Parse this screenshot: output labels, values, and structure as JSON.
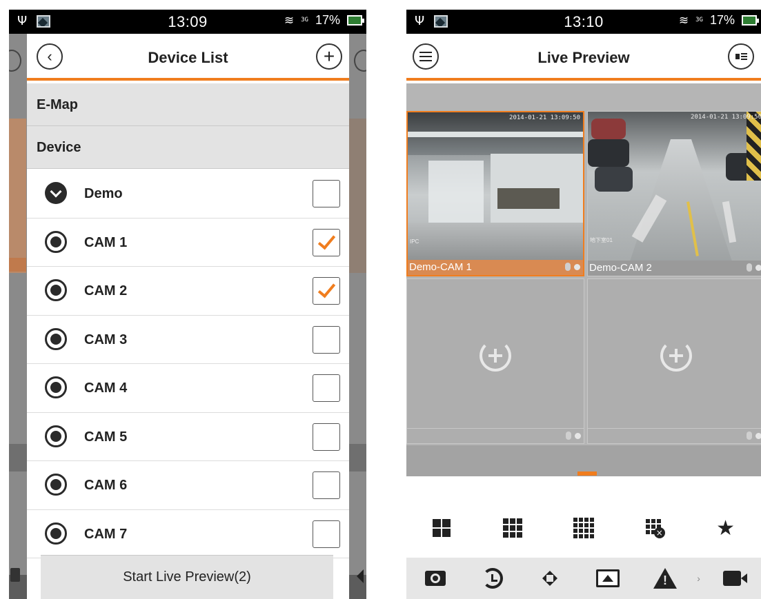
{
  "left_screen": {
    "status_bar": {
      "time": "13:09",
      "network": "3G",
      "battery": "17%"
    },
    "header": {
      "title": "Device List"
    },
    "sections": {
      "emap": "E-Map",
      "device": "Device"
    },
    "devices": [
      {
        "label": "Demo",
        "type": "group",
        "checked": false
      },
      {
        "label": "CAM 1",
        "type": "camera",
        "checked": true
      },
      {
        "label": "CAM 2",
        "type": "camera",
        "checked": true
      },
      {
        "label": "CAM 3",
        "type": "camera",
        "checked": false
      },
      {
        "label": "CAM 4",
        "type": "camera",
        "checked": false
      },
      {
        "label": "CAM 5",
        "type": "camera",
        "checked": false
      },
      {
        "label": "CAM 6",
        "type": "camera",
        "checked": false
      },
      {
        "label": "CAM 7",
        "type": "camera",
        "checked": false
      }
    ],
    "start_button": "Start Live Preview(2)"
  },
  "right_screen": {
    "status_bar": {
      "time": "13:10",
      "network": "3G",
      "battery": "17%"
    },
    "header": {
      "title": "Live Preview"
    },
    "tiles": [
      {
        "caption": "Demo-CAM 1",
        "timestamp": "2014-01-21 13:09:50",
        "osd": "IPC",
        "selected": true
      },
      {
        "caption": "Demo-CAM 2",
        "timestamp": "2014-01-21 13:09:50",
        "osd": "地下室01",
        "selected": false
      },
      {
        "caption": "",
        "empty": true
      },
      {
        "caption": "",
        "empty": true
      }
    ],
    "layout_buttons": [
      "layout-4-icon",
      "layout-9-icon",
      "layout-16-icon",
      "close-all-icon",
      "favorite-star-icon"
    ],
    "toolbar_buttons": [
      "snapshot-icon",
      "playback-icon",
      "ptz-icon",
      "display-icon",
      "alarm-icon",
      "record-icon"
    ]
  },
  "colors": {
    "accent": "#f07d1e",
    "selected_caption": "#d98a52",
    "overlay": "#8a8a8a"
  },
  "symbols": {
    "usb": "Ψ",
    "wifi": "≋",
    "plus": "+",
    "back": "‹",
    "star": "★",
    "x": "×",
    "more": "›"
  }
}
